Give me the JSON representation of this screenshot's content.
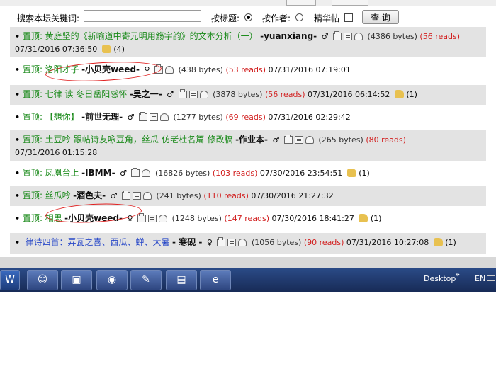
{
  "search": {
    "label": "搜索本坛关键词:",
    "value": "",
    "by_title": "按标题:",
    "by_author": "按作者:",
    "featured": "精华帖",
    "button": "查 询"
  },
  "topics": [
    {
      "pin": "置顶:",
      "title": "黄庭坚的《新喻道中寄元明用觞字韵》的文本分析（一）",
      "author": "-yuanxiang-",
      "gender": "♂",
      "bytes": "(4386 bytes)",
      "reads": "(56 reads)",
      "date": "07/31/2016  07:36:50",
      "likes": "(4)"
    },
    {
      "pin": "置顶:",
      "title": "洛阳才子",
      "author": "-小贝壳weed-",
      "gender": "♀",
      "bytes": "(438 bytes)",
      "reads": "(53 reads)",
      "date": "07/31/2016  07:19:01",
      "likes": ""
    },
    {
      "pin": "置顶:",
      "title": "七律 读 冬日岳阳感怀",
      "author": "-吴之一-",
      "gender": "♂",
      "bytes": "(3878 bytes)",
      "reads": "(56 reads)",
      "date": "07/31/2016  06:14:52",
      "likes": "(1)"
    },
    {
      "pin": "置顶:",
      "title": "【想你】",
      "author": "-前世无理-",
      "gender": "♂",
      "bytes": "(1277 bytes)",
      "reads": "(69 reads)",
      "date": "07/31/2016  02:29:42",
      "likes": ""
    },
    {
      "pin": "置顶:",
      "title": "土豆吟-跟帖诗友咏豆角，丝瓜-仿老杜名篇-修改稿",
      "author": "-作业本-",
      "gender": "♂",
      "bytes": "(265 bytes)",
      "reads": "(80 reads)",
      "date": "07/31/2016  01:15:28",
      "likes": ""
    },
    {
      "pin": "置顶:",
      "title": "凤凰台上",
      "author": "-IBMM-",
      "gender": "♂",
      "bytes": "(16826 bytes)",
      "reads": "(103 reads)",
      "date": "07/30/2016  23:54:51",
      "likes": "(1)"
    },
    {
      "pin": "置顶:",
      "title": "丝瓜吟",
      "author": "-酒色夫-",
      "gender": "♂",
      "bytes": "(241 bytes)",
      "reads": "(110 reads)",
      "date": "07/30/2016  21:27:32",
      "likes": ""
    },
    {
      "pin": "置顶:",
      "title": "相思",
      "author": "-小贝壳weed-",
      "gender": "♀",
      "bytes": "(1248 bytes)",
      "reads": "(147 reads)",
      "date": "07/30/2016  18:41:27",
      "likes": "(1)"
    },
    {
      "pin": "",
      "title": "律诗四首：弄瓦之喜、西瓜、蝉、大暑",
      "author": "- 寒砚 -",
      "gender": "♀",
      "bytes": "(1056 bytes)",
      "reads": "(90 reads)",
      "date": "07/31/2016  10:27:08",
      "likes": "(1)"
    }
  ],
  "taskbar": {
    "desktop": "Desktop",
    "lang": "EN",
    "chevron": "»",
    "icons": [
      "word-icon",
      "messenger-icon",
      "computer-icon",
      "media-player-icon",
      "paint-icon",
      "folder-icon",
      "ie-icon"
    ]
  },
  "colors": {
    "pin": "#1a8a1a",
    "reads": "#d22020",
    "taskbar": "#1f3a72",
    "alt_row": "#e3e3e3"
  }
}
